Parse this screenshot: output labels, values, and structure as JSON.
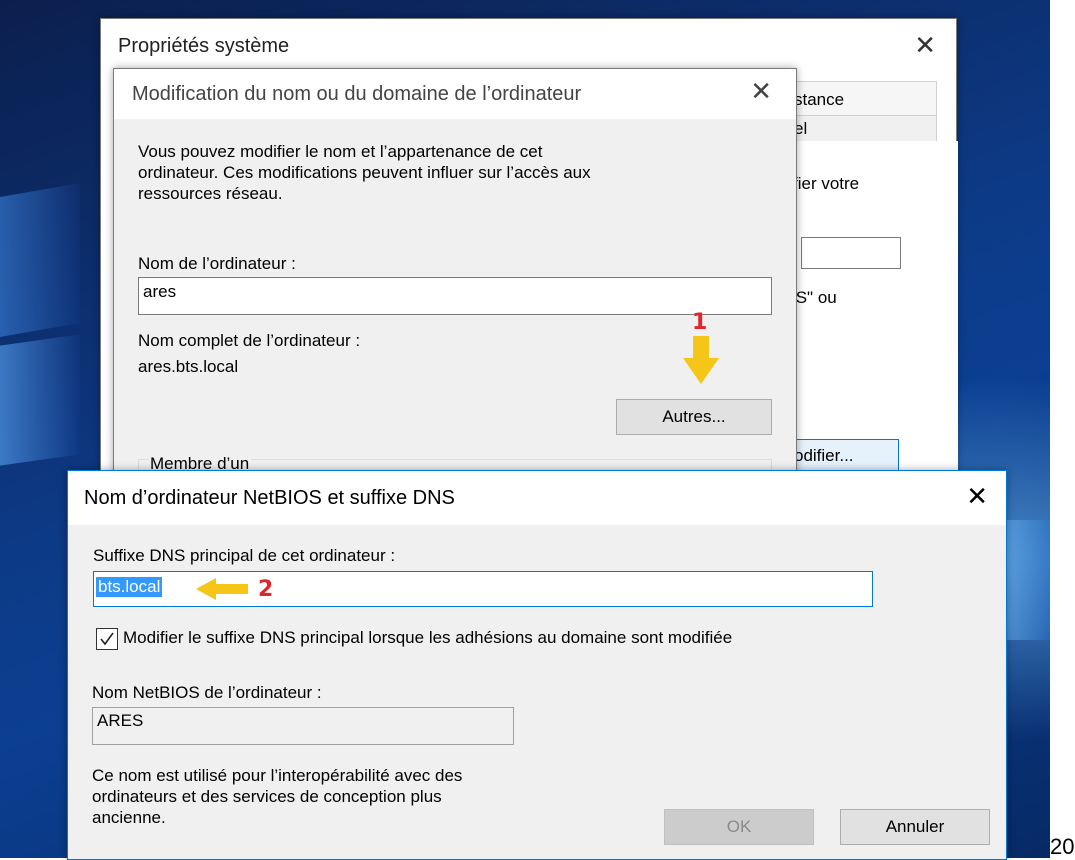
{
  "system_properties": {
    "title": "Propriétés système",
    "tab_partial_1": "stance",
    "tab_partial_2": "el",
    "text_partial_1": "fier votre",
    "text_partial_2": "IS\" ou",
    "button_partial": "odifier..."
  },
  "modify_dialog": {
    "title": "Modification du nom ou du domaine de l’ordinateur",
    "description": [
      "Vous pouvez modifier le nom et l’appartenance de cet",
      "ordinateur. Ces modifications peuvent influer sur l’accès aux",
      "ressources réseau."
    ],
    "computer_name_label": "Nom de l’ordinateur :",
    "computer_name_value": "ares",
    "full_name_label": "Nom complet de l’ordinateur :",
    "full_name_value": "ares.bts.local",
    "more_button": "Autres...",
    "member_of_label": "Membre d’un"
  },
  "netbios_dialog": {
    "title": "Nom d’ordinateur NetBIOS et suffixe DNS",
    "dns_suffix_label": "Suffixe DNS principal de cet ordinateur :",
    "dns_suffix_value": "bts.local",
    "checkbox_label": "Modifier le suffixe DNS principal lorsque les adhésions au domaine sont modifiée",
    "checkbox_checked": true,
    "netbios_label": "Nom NetBIOS de l’ordinateur :",
    "netbios_value": "ARES",
    "info_text": [
      "Ce nom est utilisé pour l’interopérabilité avec des",
      "ordinateurs et des services de conception plus",
      "ancienne."
    ],
    "ok_button": "OK",
    "cancel_button": "Annuler"
  },
  "annotations": {
    "step1": "1",
    "step2": "2",
    "arrow_color": "#f5c518",
    "number_color": "#e0262b"
  },
  "page_number": "20"
}
